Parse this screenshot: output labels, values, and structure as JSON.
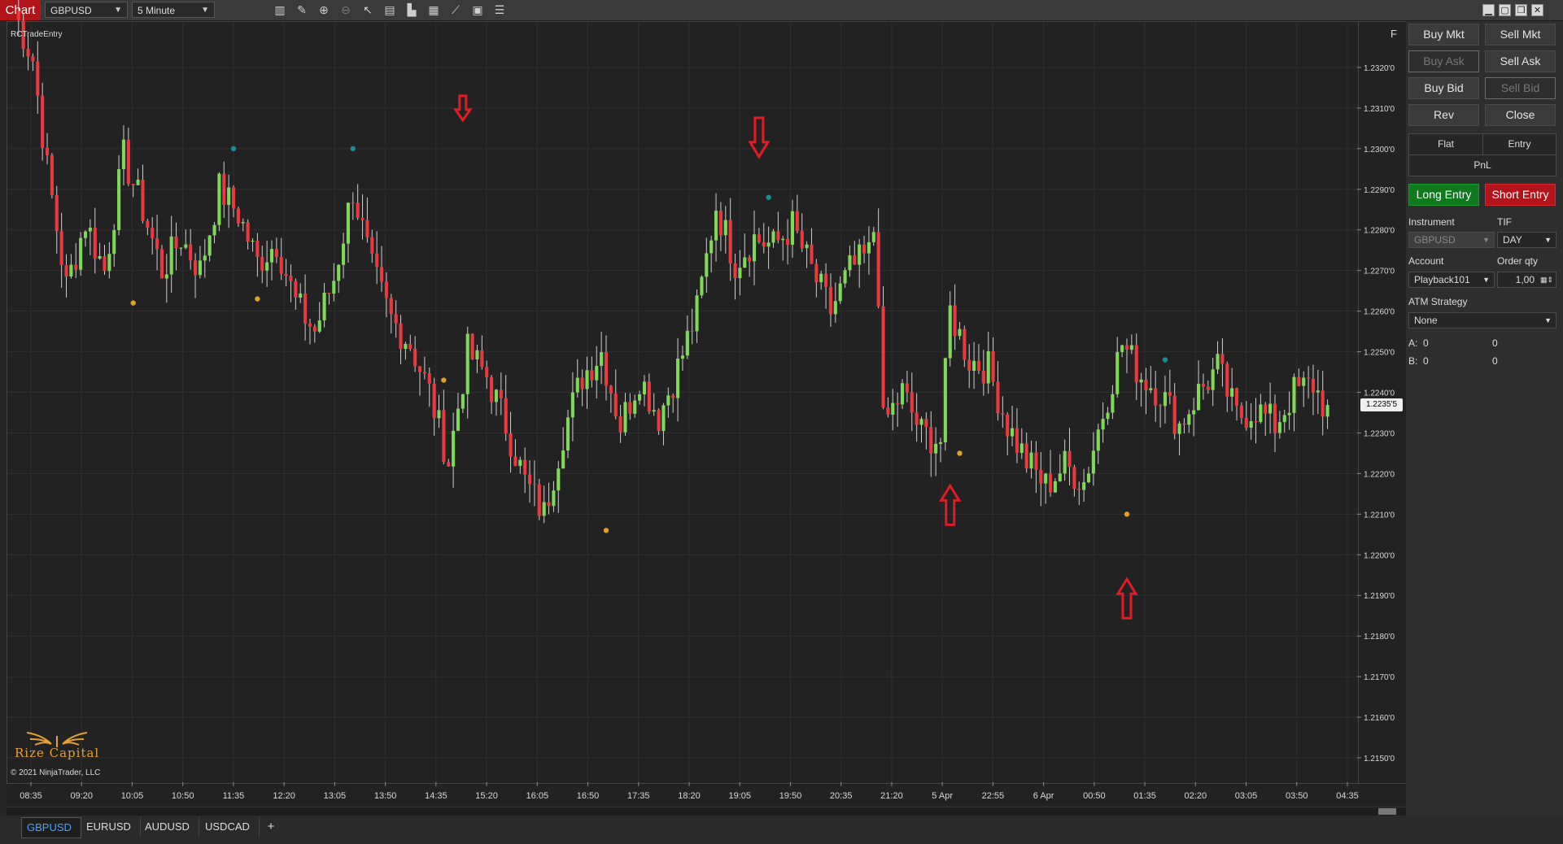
{
  "toolbar": {
    "chart_tab": "Chart",
    "instrument": "GBPUSD",
    "interval": "5 Minute",
    "icons": [
      "bar-type-icon",
      "draw-tool-icon",
      "zoom-in-icon",
      "zoom-out-icon",
      "pointer-icon",
      "properties-icon",
      "indicators-icon",
      "strategies-icon",
      "templates-icon",
      "share-icon",
      "list-icon"
    ],
    "window_buttons": [
      "minimize",
      "tile",
      "restore",
      "close"
    ]
  },
  "chart": {
    "indicator_label": "RCTradeEntry",
    "f_button": "F",
    "copyright": "© 2021 NinjaTrader, LLC",
    "logo_text": "Rize Capital",
    "last_price": "1.2235'5",
    "colors": {
      "up": "#7ed957",
      "down": "#e8393f",
      "background": "#222222",
      "grid": "#2f2f2f",
      "signal_high": "#1a8f8f",
      "signal_low": "#e0a020",
      "arrow": "#e21b24"
    }
  },
  "chart_data": {
    "type": "candlestick",
    "price_ticks": [
      "1.2320'0",
      "1.2310'0",
      "1.2300'0",
      "1.2290'0",
      "1.2280'0",
      "1.2270'0",
      "1.2260'0",
      "1.2250'0",
      "1.2240'0",
      "1.2230'0",
      "1.2220'0",
      "1.2210'0",
      "1.2200'0",
      "1.2190'0",
      "1.2180'0",
      "1.2170'0",
      "1.2160'0",
      "1.2150'0"
    ],
    "ylim": [
      1.2144,
      1.2331
    ],
    "time_ticks": [
      "08:35",
      "09:20",
      "10:05",
      "10:50",
      "11:35",
      "12:20",
      "13:05",
      "13:50",
      "14:35",
      "15:20",
      "16:05",
      "16:50",
      "17:35",
      "18:20",
      "19:05",
      "19:50",
      "20:35",
      "21:20",
      "5 Apr",
      "22:55",
      "6 Apr",
      "00:50",
      "01:35",
      "02:20",
      "03:05",
      "03:50",
      "04:35"
    ],
    "path": [
      [
        0,
        1.2334
      ],
      [
        4,
        1.2322
      ],
      [
        7,
        1.2295
      ],
      [
        11,
        1.2266
      ],
      [
        15,
        1.2282
      ],
      [
        19,
        1.227
      ],
      [
        23,
        1.2298
      ],
      [
        27,
        1.2285
      ],
      [
        31,
        1.227
      ],
      [
        35,
        1.2278
      ],
      [
        39,
        1.227
      ],
      [
        43,
        1.229
      ],
      [
        47,
        1.2284
      ],
      [
        51,
        1.2272
      ],
      [
        55,
        1.2277
      ],
      [
        59,
        1.2262
      ],
      [
        63,
        1.2255
      ],
      [
        67,
        1.2268
      ],
      [
        71,
        1.229
      ],
      [
        75,
        1.227
      ],
      [
        79,
        1.2258
      ],
      [
        83,
        1.2252
      ],
      [
        87,
        1.224
      ],
      [
        91,
        1.2223
      ],
      [
        95,
        1.225
      ],
      [
        99,
        1.2244
      ],
      [
        103,
        1.2232
      ],
      [
        107,
        1.2218
      ],
      [
        111,
        1.221
      ],
      [
        115,
        1.223
      ],
      [
        119,
        1.2244
      ],
      [
        123,
        1.225
      ],
      [
        127,
        1.2232
      ],
      [
        131,
        1.2244
      ],
      [
        135,
        1.2234
      ],
      [
        139,
        1.2246
      ],
      [
        143,
        1.226
      ],
      [
        147,
        1.2286
      ],
      [
        151,
        1.2272
      ],
      [
        155,
        1.2278
      ],
      [
        159,
        1.2276
      ],
      [
        163,
        1.2281
      ],
      [
        167,
        1.227
      ],
      [
        171,
        1.226
      ],
      [
        175,
        1.227
      ],
      [
        179,
        1.2274
      ],
      [
        180,
        1.228
      ],
      [
        181,
        1.2265
      ],
      [
        182,
        1.2232
      ],
      [
        186,
        1.224
      ],
      [
        190,
        1.223
      ],
      [
        194,
        1.2228
      ],
      [
        196,
        1.226
      ],
      [
        200,
        1.2248
      ],
      [
        204,
        1.2246
      ],
      [
        208,
        1.2232
      ],
      [
        212,
        1.2223
      ],
      [
        216,
        1.2217
      ],
      [
        220,
        1.2222
      ],
      [
        224,
        1.2218
      ],
      [
        228,
        1.2235
      ],
      [
        232,
        1.2252
      ],
      [
        236,
        1.2244
      ],
      [
        240,
        1.224
      ],
      [
        244,
        1.2232
      ],
      [
        248,
        1.224
      ],
      [
        252,
        1.2246
      ],
      [
        256,
        1.2234
      ],
      [
        260,
        1.2236
      ],
      [
        264,
        1.2232
      ],
      [
        268,
        1.224
      ],
      [
        272,
        1.2242
      ],
      [
        275,
        1.2235
      ]
    ],
    "signals": [
      {
        "bar": 46,
        "price": 1.23,
        "kind": "high"
      },
      {
        "bar": 71,
        "price": 1.23,
        "kind": "high"
      },
      {
        "bar": 158,
        "price": 1.2288,
        "kind": "high"
      },
      {
        "bar": 241,
        "price": 1.2248,
        "kind": "high"
      },
      {
        "bar": 25,
        "price": 1.2262,
        "kind": "low"
      },
      {
        "bar": 51,
        "price": 1.2263,
        "kind": "low"
      },
      {
        "bar": 90,
        "price": 1.2243,
        "kind": "low"
      },
      {
        "bar": 124,
        "price": 1.2206,
        "kind": "low"
      },
      {
        "bar": 198,
        "price": 1.2225,
        "kind": "low"
      },
      {
        "bar": 233,
        "price": 1.221,
        "kind": "low"
      }
    ],
    "arrows": [
      {
        "bar": 94,
        "price": 1.2307,
        "dir": "down"
      },
      {
        "bar": 156,
        "price": 1.2298,
        "dir": "down"
      },
      {
        "bar": 196,
        "price": 1.2217,
        "dir": "up"
      },
      {
        "bar": 233,
        "price": 1.2194,
        "dir": "up"
      }
    ]
  },
  "panel": {
    "buy_mkt": "Buy Mkt",
    "sell_mkt": "Sell Mkt",
    "buy_ask": "Buy Ask",
    "sell_ask": "Sell Ask",
    "buy_bid": "Buy Bid",
    "sell_bid": "Sell Bid",
    "rev": "Rev",
    "close": "Close",
    "flat": "Flat",
    "entry": "Entry",
    "pnl": "PnL",
    "long_entry": "Long Entry",
    "short_entry": "Short Entry",
    "instrument_label": "Instrument",
    "instrument_value": "GBPUSD",
    "tif_label": "TIF",
    "tif_value": "DAY",
    "account_label": "Account",
    "account_value": "Playback101",
    "qty_label": "Order qty",
    "qty_value": "1,00",
    "atm_label": "ATM Strategy",
    "atm_value": "None",
    "a_label": "A:",
    "a_val1": "0",
    "a_val2": "0",
    "b_label": "B:",
    "b_val1": "0",
    "b_val2": "0"
  },
  "tabs": [
    "GBPUSD",
    "EURUSD",
    "AUDUSD",
    "USDCAD"
  ],
  "add_tab": "+"
}
